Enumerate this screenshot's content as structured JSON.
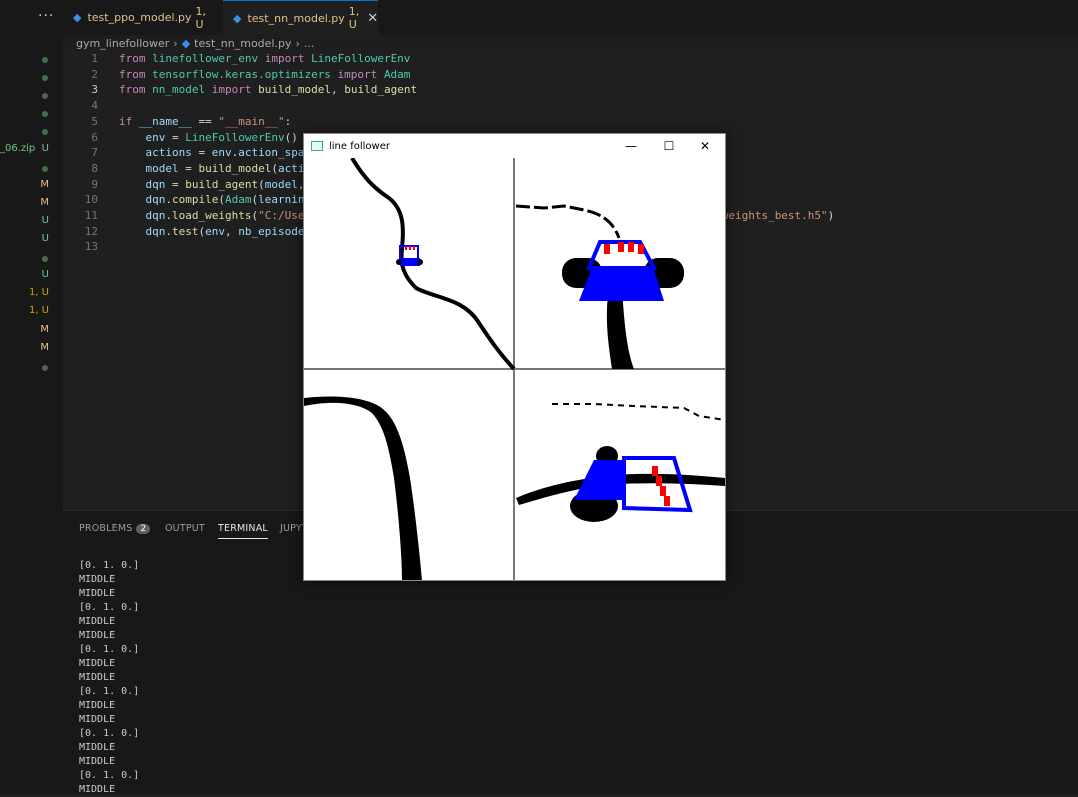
{
  "sidebar": {
    "menu_icon": "ellipsis-icon",
    "items": [
      {
        "file": "",
        "status": ""
      },
      {
        "file": "",
        "status": ""
      },
      {
        "file": "",
        "status": ""
      },
      {
        "file": "",
        "status": ""
      },
      {
        "file": "",
        "status": ""
      },
      {
        "file": "_06.zip",
        "status": "U"
      },
      {
        "file": "",
        "status": ""
      },
      {
        "file": "",
        "status": "M"
      },
      {
        "file": "",
        "status": "M"
      },
      {
        "file": "",
        "status": "U"
      },
      {
        "file": "",
        "status": "U"
      },
      {
        "file": "",
        "status": ""
      },
      {
        "file": "",
        "status": "U"
      },
      {
        "file": "",
        "status": "1, U"
      },
      {
        "file": "",
        "status": "1, U"
      },
      {
        "file": "",
        "status": "M"
      },
      {
        "file": "",
        "status": "M"
      },
      {
        "file": "",
        "status": ""
      }
    ]
  },
  "tabs": [
    {
      "label": "test_ppo_model.py",
      "badge": "1, U"
    },
    {
      "label": "test_nn_model.py",
      "badge": "1, U"
    }
  ],
  "breadcrumb": {
    "folder": "gym_linefollower",
    "file": "test_nn_model.py",
    "more": "..."
  },
  "code": {
    "line_numbers": [
      "1",
      "2",
      "3",
      "4",
      "5",
      "6",
      "7",
      "8",
      "9",
      "10",
      "11",
      "12",
      "13"
    ]
  },
  "panel": {
    "tabs": [
      "PROBLEMS",
      "OUTPUT",
      "TERMINAL",
      "JUPYT"
    ],
    "problems_count": "2",
    "terminal_lines": [
      "[0. 1. 0.]",
      "MIDDLE",
      "MIDDLE",
      "[0. 1. 0.]",
      "MIDDLE",
      "MIDDLE",
      "[0. 1. 0.]",
      "MIDDLE",
      "MIDDLE",
      "[0. 1. 0.]",
      "MIDDLE",
      "MIDDLE",
      "[0. 1. 0.]",
      "MIDDLE",
      "MIDDLE",
      "[0. 1. 0.]",
      "MIDDLE"
    ]
  },
  "window": {
    "title": "line follower",
    "minimize": "—",
    "maximize": "☐",
    "close": "✕"
  },
  "colors": {
    "accent": "#0078d4",
    "robot_blue": "#0000ff",
    "sensor_red": "#ff0000"
  }
}
